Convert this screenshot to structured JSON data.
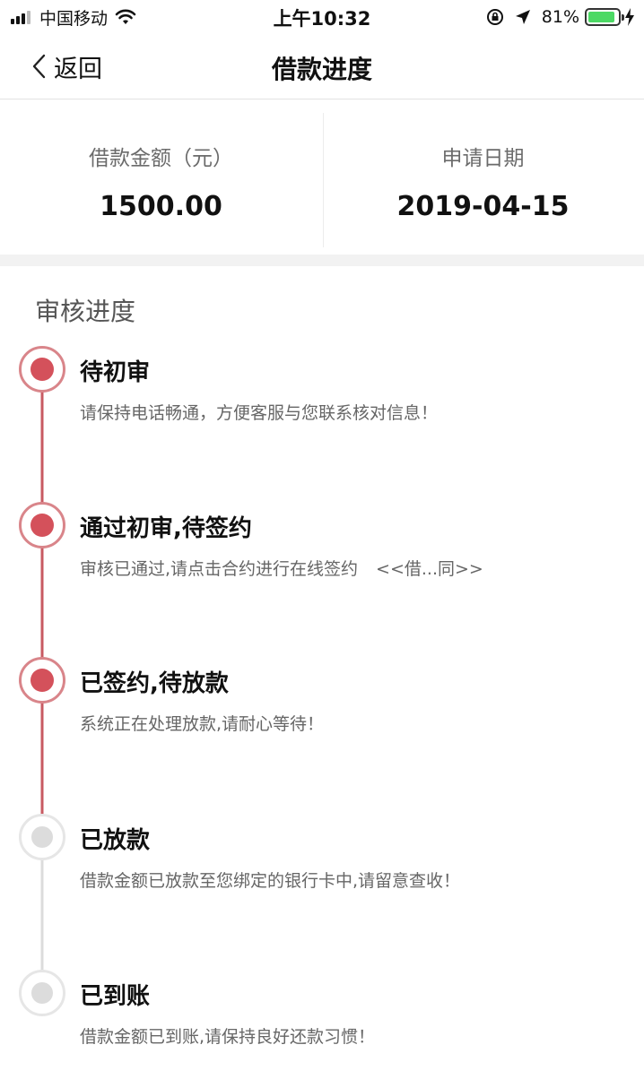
{
  "status_bar": {
    "carrier": "中国移动",
    "time": "上午10:32",
    "battery": "81%",
    "battery_level": 0.81,
    "icons": [
      "signal-icon",
      "wifi-icon",
      "rotation-lock-icon",
      "location-arrow-icon",
      "battery-icon",
      "charging-bolt-icon"
    ]
  },
  "nav": {
    "back_label": "返回",
    "title": "借款进度"
  },
  "summary": {
    "amount_label": "借款金额（元）",
    "amount_value": "1500.00",
    "date_label": "申请日期",
    "date_value": "2019-04-15"
  },
  "progress": {
    "title": "审核进度",
    "steps": [
      {
        "title": "待初审",
        "desc": "请保持电话畅通，方便客服与您联系核对信息！",
        "status": "done"
      },
      {
        "title": "通过初审,待签约",
        "desc": "审核已通过,请点击合约进行在线签约",
        "link": "<<借...同>>",
        "status": "done"
      },
      {
        "title": "已签约,待放款",
        "desc": "系统正在处理放款,请耐心等待！",
        "status": "done"
      },
      {
        "title": "已放款",
        "desc": "借款金额已放款至您绑定的银行卡中,请留意查收！",
        "status": "pending"
      },
      {
        "title": "已到账",
        "desc": "借款金额已到账,请保持良好还款习惯！",
        "status": "pending"
      }
    ]
  },
  "colors": {
    "accent": "#d4515b",
    "accent_ring": "#d9858a",
    "line_active": "#c85a62",
    "line_pending": "#dcdcdc"
  }
}
